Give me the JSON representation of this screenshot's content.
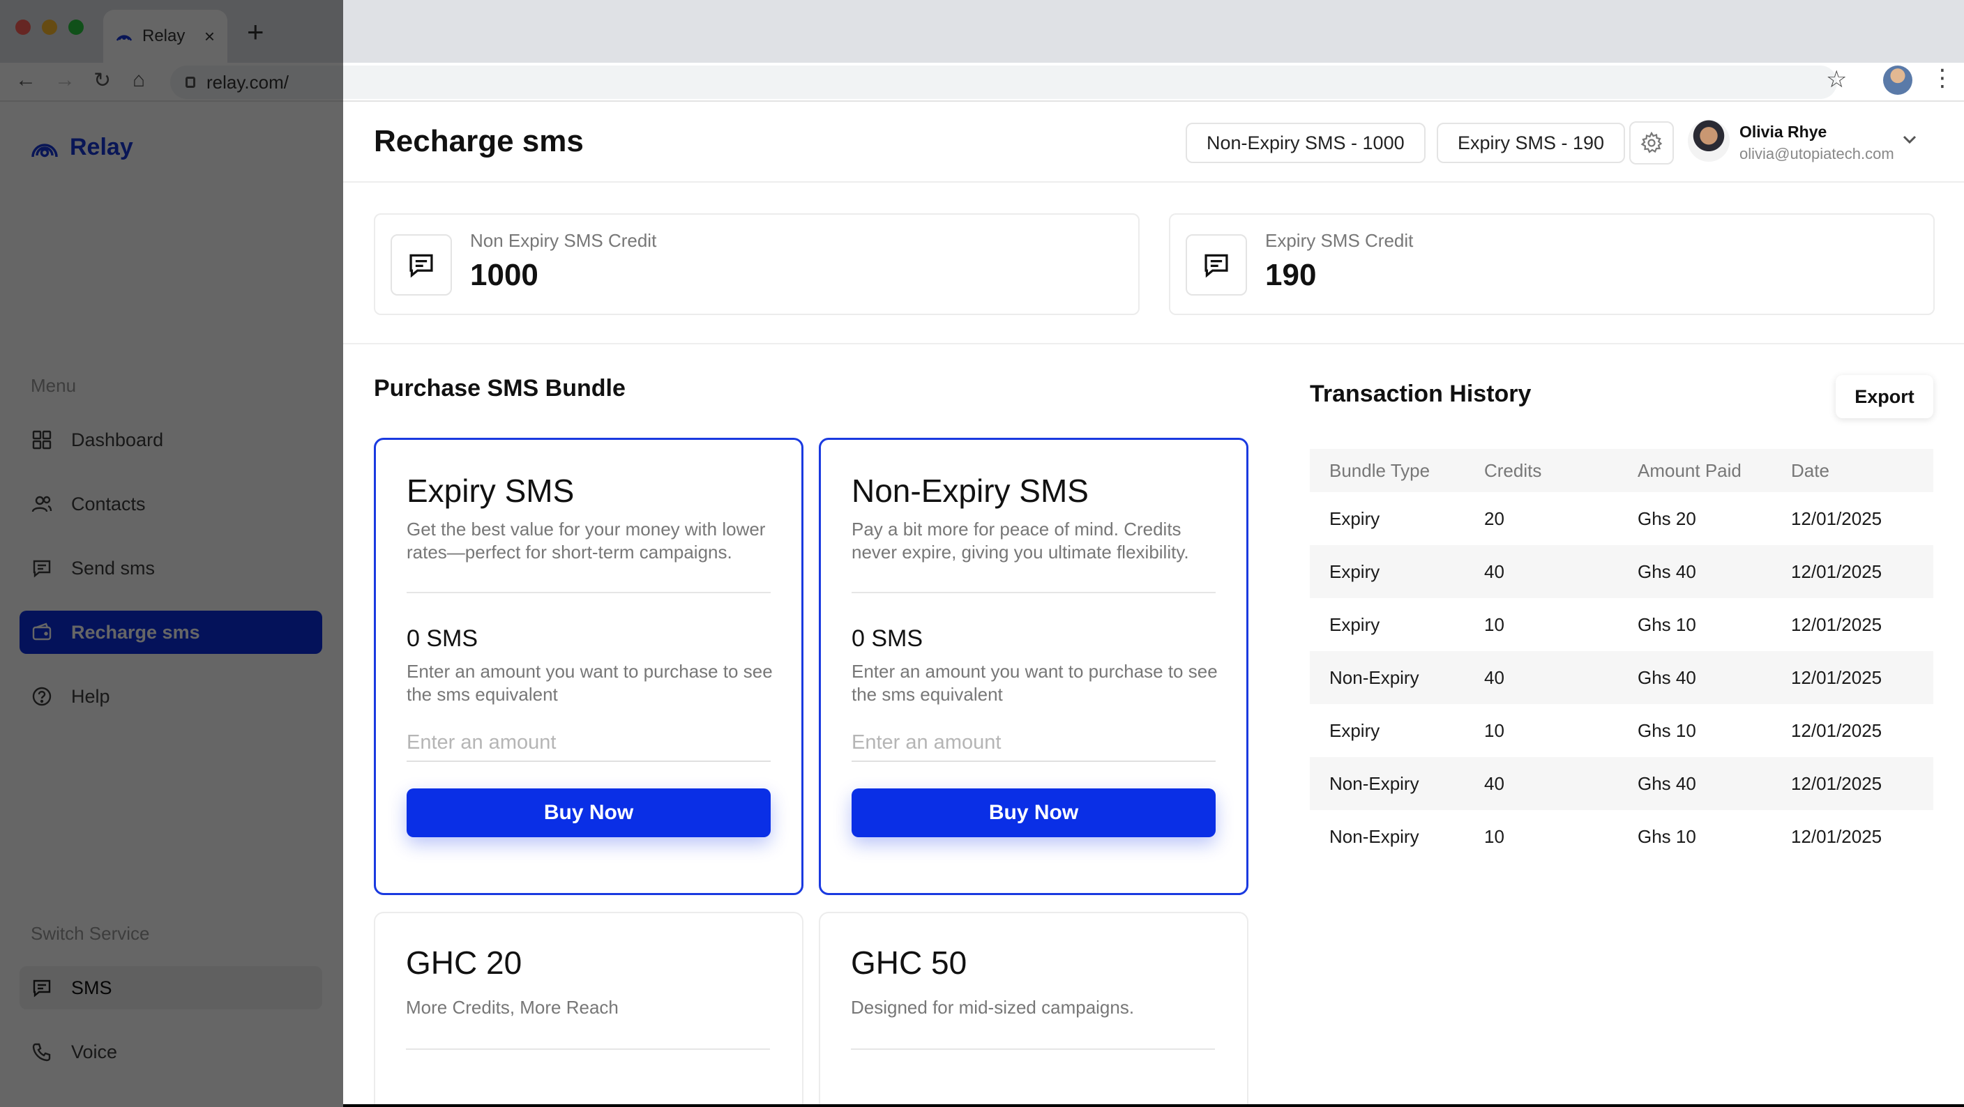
{
  "browser": {
    "tab_title": "Relay",
    "tab_close": "×",
    "new_tab": "+",
    "url": "relay.com/"
  },
  "sidebar": {
    "brand": "Relay",
    "menu_label": "Menu",
    "items": [
      {
        "label": "Dashboard",
        "icon": "grid-icon"
      },
      {
        "label": "Contacts",
        "icon": "users-icon"
      },
      {
        "label": "Send sms",
        "icon": "message-icon"
      },
      {
        "label": "Recharge sms",
        "icon": "wallet-icon"
      },
      {
        "label": "Help",
        "icon": "help-icon"
      }
    ],
    "switch_label": "Switch Service",
    "services": [
      {
        "label": "SMS",
        "icon": "message-icon"
      },
      {
        "label": "Voice",
        "icon": "phone-icon"
      }
    ]
  },
  "header": {
    "title": "Recharge sms",
    "non_expiry_pill": "Non-Expiry SMS -  1000",
    "expiry_pill": "Expiry SMS -  190",
    "user_name": "Olivia Rhye",
    "user_email": "olivia@utopiatech.com"
  },
  "credits": {
    "non_expiry_label": "Non Expiry SMS Credit",
    "non_expiry_value": "1000",
    "expiry_label": "Expiry SMS Credit",
    "expiry_value": "190"
  },
  "purchase": {
    "title": "Purchase SMS Bundle",
    "bundles": [
      {
        "title": "Expiry SMS",
        "desc": "Get the best value for your money with lower rates—perfect for short-term campaigns.",
        "sms": "0 SMS",
        "hint": "Enter an amount you want to purchase to see the sms equivalent",
        "placeholder": "Enter an amount",
        "button": "Buy Now"
      },
      {
        "title": "Non-Expiry SMS",
        "desc": "Pay a bit more for peace of mind. Credits never expire, giving you ultimate flexibility.",
        "sms": "0 SMS",
        "hint": "Enter an amount you want to purchase to see the sms equivalent",
        "placeholder": "Enter an amount",
        "button": "Buy Now"
      }
    ],
    "packages": [
      {
        "title": "GHC 20",
        "desc": "More Credits, More Reach"
      },
      {
        "title": "GHC 50",
        "desc": "Designed for mid-sized campaigns."
      }
    ]
  },
  "transactions": {
    "title": "Transaction History",
    "export": "Export",
    "columns": [
      "Bundle Type",
      "Credits",
      "Amount Paid",
      "Date"
    ],
    "rows": [
      [
        "Expiry",
        "20",
        "Ghs 20",
        "12/01/2025"
      ],
      [
        "Expiry",
        "40",
        "Ghs 40",
        "12/01/2025"
      ],
      [
        "Expiry",
        "10",
        "Ghs 10",
        "12/01/2025"
      ],
      [
        "Non-Expiry",
        "40",
        "Ghs 40",
        "12/01/2025"
      ],
      [
        "Expiry",
        "10",
        "Ghs 10",
        "12/01/2025"
      ],
      [
        "Non-Expiry",
        "40",
        "Ghs 40",
        "12/01/2025"
      ],
      [
        "Non-Expiry",
        "10",
        "Ghs 10",
        "12/01/2025"
      ]
    ]
  },
  "colors": {
    "accent": "#0a2fe6",
    "brand": "#1838d8",
    "active_nav": "#0a2fe0"
  }
}
